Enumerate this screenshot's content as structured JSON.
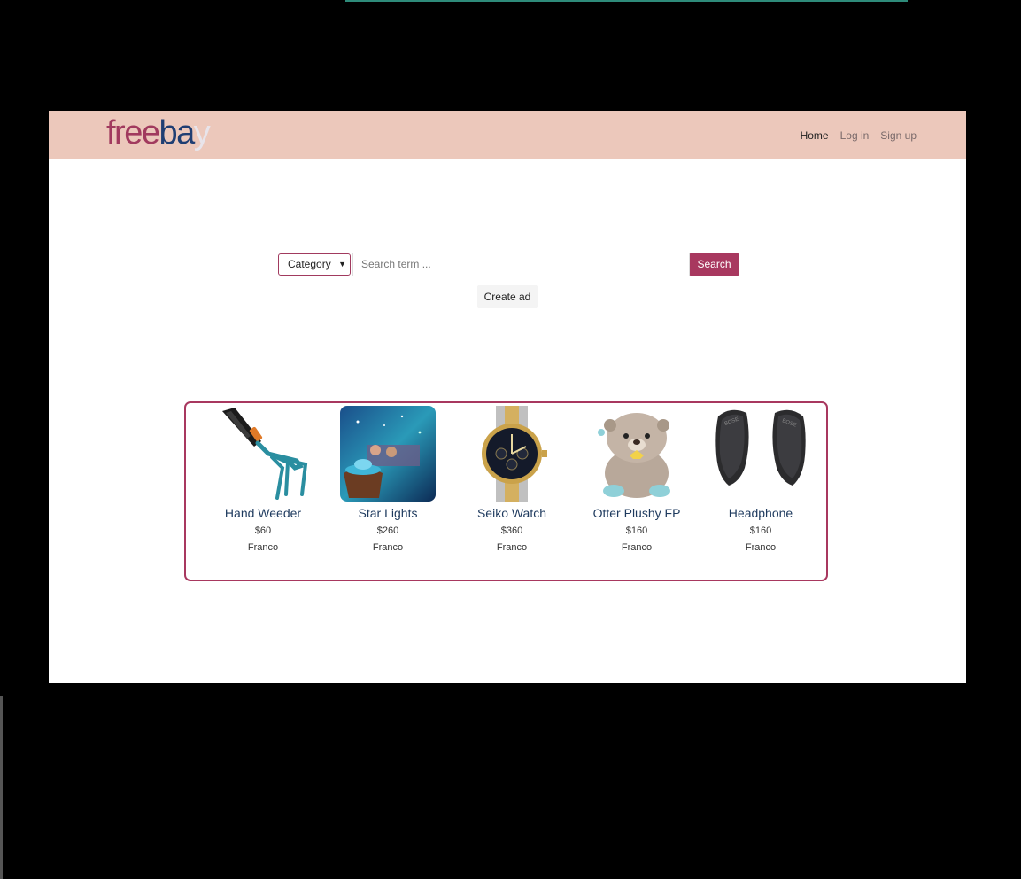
{
  "brand": {
    "logo_text": "freebay"
  },
  "nav": {
    "links": [
      {
        "label": "Home"
      },
      {
        "label": "Log in"
      },
      {
        "label": "Sign up"
      }
    ]
  },
  "search": {
    "category_label": "Category",
    "placeholder": "Search term ...",
    "button_label": "Search"
  },
  "create_ad_label": "Create ad",
  "listings": [
    {
      "title": "Hand Weeder",
      "price": "$60",
      "seller": "Franco",
      "icon": "hand-weeder-image"
    },
    {
      "title": "Star Lights",
      "price": "$260",
      "seller": "Franco",
      "icon": "star-lights-image"
    },
    {
      "title": "Seiko Watch",
      "price": "$360",
      "seller": "Franco",
      "icon": "watch-image"
    },
    {
      "title": "Otter Plushy FP",
      "price": "$160",
      "seller": "Franco",
      "icon": "otter-plushy-image"
    },
    {
      "title": "Headphone",
      "price": "$160",
      "seller": "Franco",
      "icon": "headphone-image"
    }
  ],
  "colors": {
    "navbar": "#ecc8bb",
    "accent": "#a8385f",
    "title": "#1e3a5e"
  }
}
